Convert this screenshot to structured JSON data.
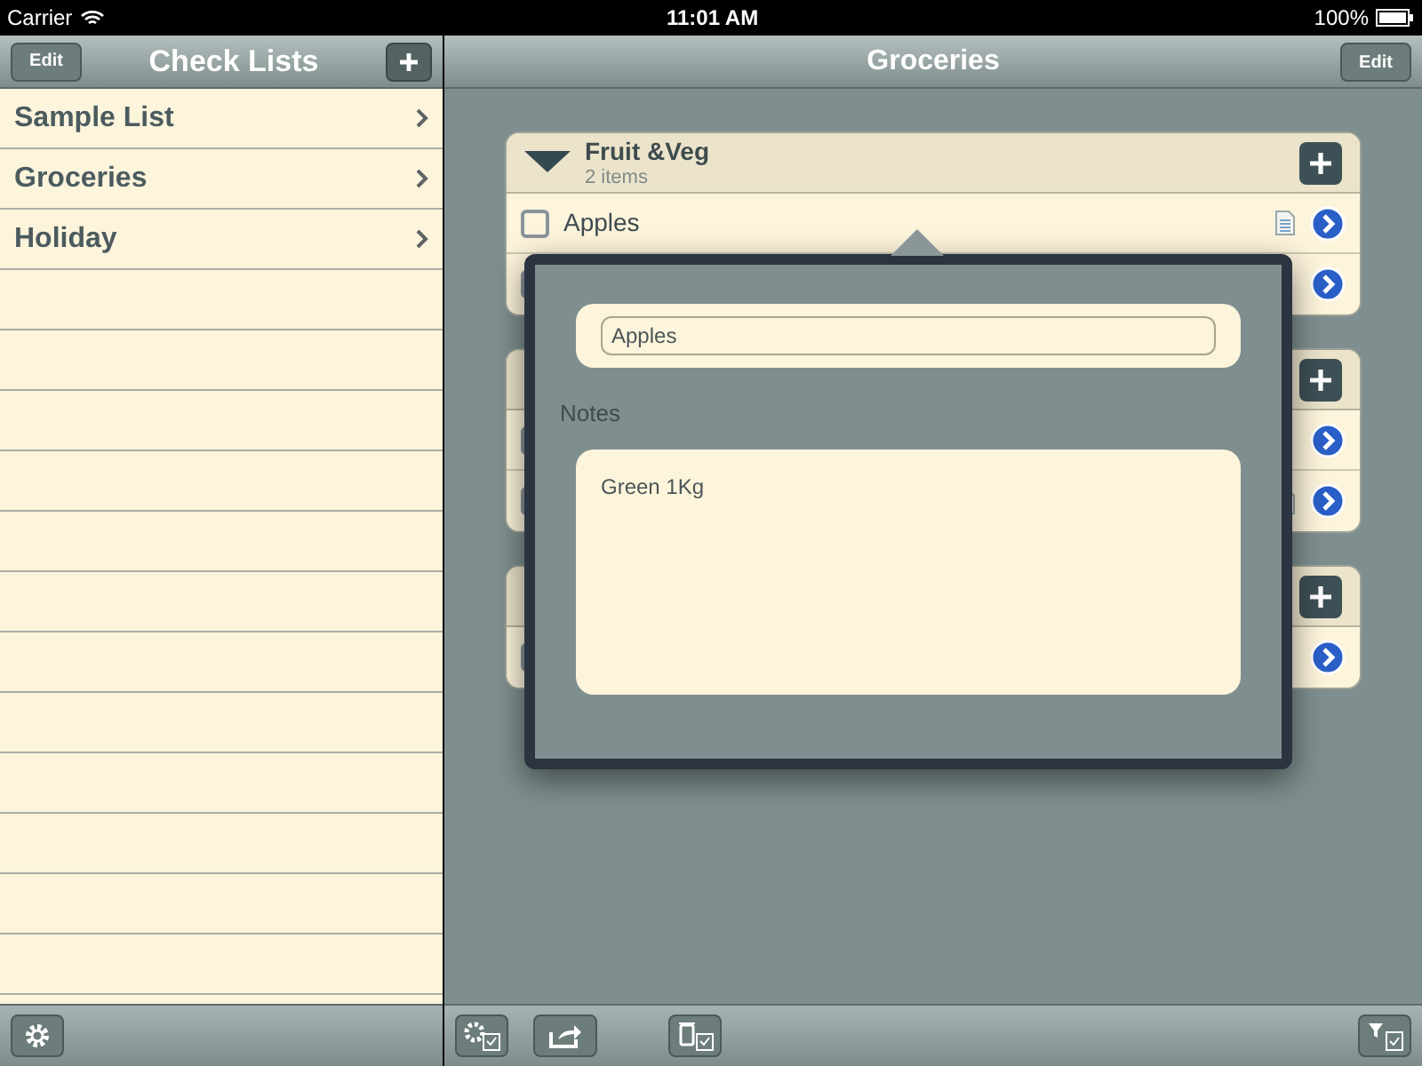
{
  "status_bar": {
    "carrier": "Carrier",
    "time": "11:01 AM",
    "battery": "100%"
  },
  "sidebar": {
    "title": "Check Lists",
    "edit_button": "Edit",
    "items": [
      {
        "label": "Sample List"
      },
      {
        "label": "Groceries"
      },
      {
        "label": "Holiday"
      }
    ]
  },
  "main": {
    "title": "Groceries",
    "edit_button": "Edit",
    "sections": [
      {
        "title": "Fruit &Veg",
        "count": "2 items",
        "expanded": true,
        "items": [
          {
            "label": "Apples",
            "checked": false,
            "has_note": true
          },
          {
            "checked": false,
            "has_note": false
          }
        ]
      },
      {
        "items": [
          {
            "checked": false,
            "has_note": false
          },
          {
            "checked": false,
            "has_note": true
          }
        ]
      },
      {
        "items": [
          {
            "checked": false,
            "has_note": false
          }
        ]
      }
    ]
  },
  "popover": {
    "name_value": "Apples",
    "notes_label": "Notes",
    "notes_value": "Green 1Kg"
  }
}
